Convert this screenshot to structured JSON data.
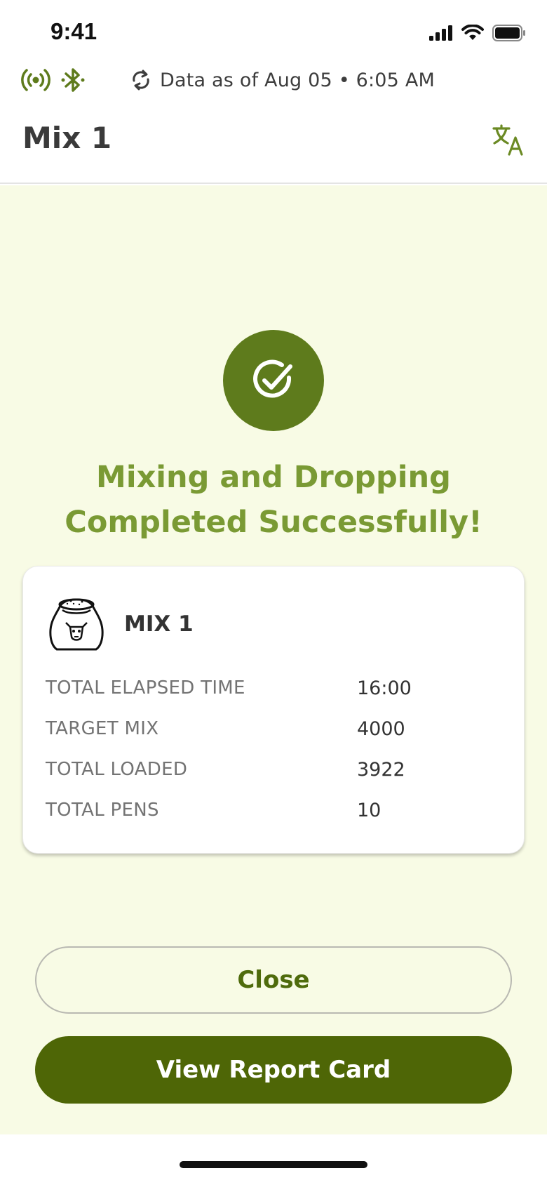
{
  "status_bar": {
    "time": "9:41"
  },
  "connectivity": {
    "sync_text": "Data as of Aug 05 • 6:05 AM",
    "icons": [
      "broadcast-icon",
      "bluetooth-icon",
      "sync-icon"
    ]
  },
  "header": {
    "title": "Mix 1",
    "translate_icon": "translate-icon"
  },
  "success": {
    "icon": "check-circle-icon",
    "line1": "Mixing and Dropping",
    "line2": "Completed Successfully!"
  },
  "summary": {
    "icon": "feed-sack-icon",
    "title": "MIX 1",
    "stats": [
      {
        "label": "TOTAL ELAPSED TIME",
        "value": "16:00"
      },
      {
        "label": "TARGET MIX",
        "value": "4000"
      },
      {
        "label": "TOTAL LOADED",
        "value": "3922"
      },
      {
        "label": "TOTAL PENS",
        "value": "10"
      }
    ]
  },
  "actions": {
    "close_label": "Close",
    "report_label": "View Report Card"
  },
  "colors": {
    "accent": "#5e7b1c",
    "accent_text": "#7a9a34",
    "button_dark": "#4e6606",
    "background": "#f8fbe5"
  }
}
